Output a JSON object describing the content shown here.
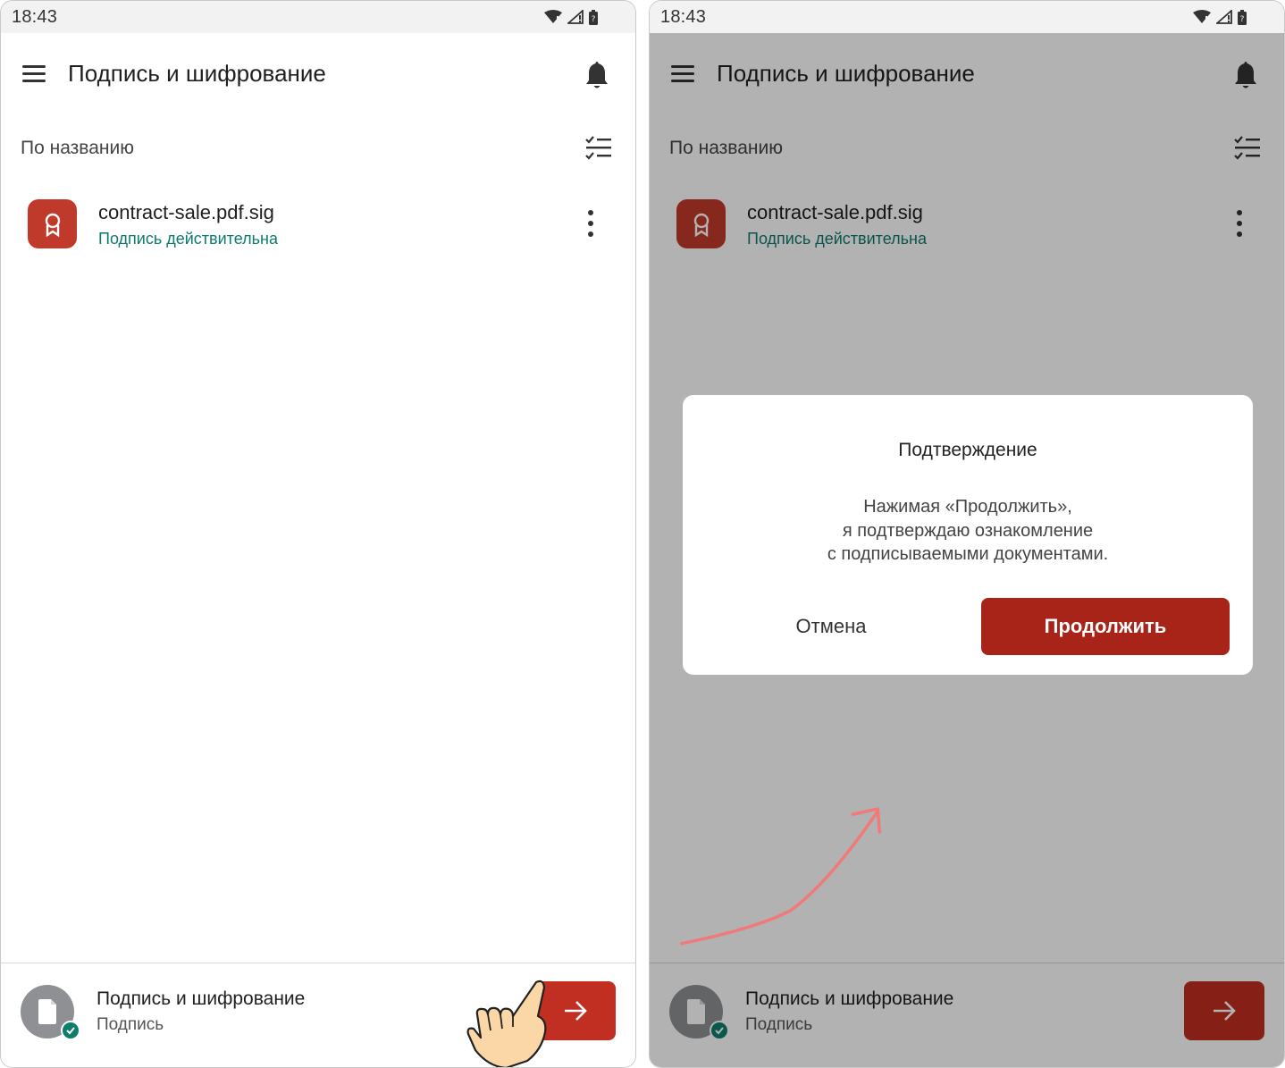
{
  "status_bar": {
    "time": "18:43"
  },
  "app": {
    "title": "Подпись и шифрование",
    "sort_label": "По названию"
  },
  "file": {
    "name": "contract-sale.pdf.sig",
    "status": "Подпись действительна"
  },
  "bottom_bar": {
    "title": "Подпись и шифрование",
    "subtitle": "Подпись"
  },
  "dialog": {
    "title": "Подтверждение",
    "body_lines": [
      "Нажимая «Продолжить»,",
      "я подтверждаю ознакомление",
      "с подписываемыми документами."
    ],
    "cancel_label": "Отмена",
    "continue_label": "Продолжить"
  },
  "colors": {
    "accent": "#c12e22",
    "dialog_accent": "#a82419",
    "valid_status": "#0d7a6f",
    "scrim": "rgba(0,0,0,0.30)",
    "annotation_arrow": "#f07a7a"
  },
  "icons": [
    "menu-icon",
    "bell-icon",
    "sort-checklist-icon",
    "certificate-icon",
    "more-vert-icon",
    "document-icon",
    "check-icon",
    "arrow-right-icon",
    "wifi-icon",
    "signal-icon",
    "battery-icon",
    "pointing-hand-icon"
  ]
}
